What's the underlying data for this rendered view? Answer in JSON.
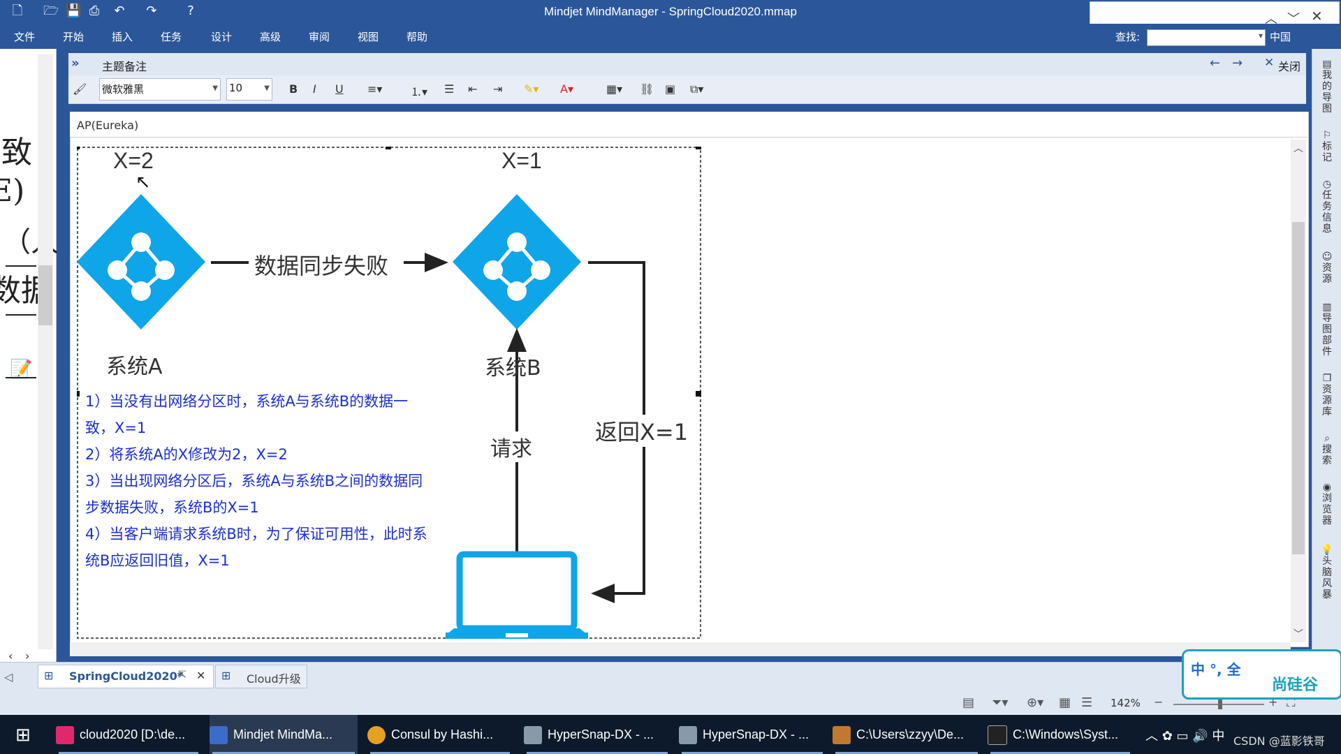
{
  "titlebar": {
    "title": "Mindjet MindManager - SpringCloud2020.mmap"
  },
  "ribbon": {
    "tabs": [
      "文件",
      "开始",
      "插入",
      "任务",
      "设计",
      "高级",
      "审阅",
      "视图",
      "帮助"
    ],
    "find_label": "查找:",
    "lang_label": "中国"
  },
  "notes": {
    "title": "主题备注",
    "close_label": "关闭",
    "font_name": "微软雅黑",
    "font_size": "10",
    "bold": "B",
    "italic": "I",
    "underline": "U",
    "topic": "AP(Eureka)"
  },
  "left_pane": {
    "chars": [
      "致",
      "E)",
      "（人",
      "数据"
    ]
  },
  "figure": {
    "label_x2": "X=2",
    "label_x1": "X=1",
    "arrow_label": "数据同步失败",
    "system_a": "系统A",
    "system_b": "系统B",
    "request": "请求",
    "return": "返回X=1",
    "notes": [
      "1）当没有出网络分区时，系统A与系统B的数据一",
      "致，X=1",
      "2）将系统A的X修改为2，X=2",
      "3）当出现网络分区后，系统A与系统B之间的数据同",
      "步数据失败，系统B的X=1",
      "4）当客户端请求系统B时，为了保证可用性，此时系",
      "统B应返回旧值，X=1"
    ],
    "diamond_color": "#0ea5e9",
    "note_color": "#1a2fd0"
  },
  "right_pane": {
    "items": [
      "我的导图",
      "标记",
      "任务信息",
      "资源",
      "导图部件",
      "资源库",
      "搜索",
      "浏览器",
      "头脑风暴"
    ]
  },
  "doc_tabs": [
    {
      "label": "SpringCloud2020*"
    },
    {
      "label": "Cloud升级"
    }
  ],
  "status": {
    "zoom": "142%"
  },
  "ime": {
    "text": "中 °, 全",
    "brand": "尚硅谷"
  },
  "taskbar": {
    "items": [
      {
        "label": "cloud2020 [D:\\de...",
        "color": "#e0286e"
      },
      {
        "label": "Mindjet MindMa...",
        "color": "#3b6cc9"
      },
      {
        "label": "Consul by Hashi...",
        "color": "#e8a020"
      },
      {
        "label": "HyperSnap-DX - ...",
        "color": "#8899aa"
      },
      {
        "label": "HyperSnap-DX - ...",
        "color": "#8899aa"
      },
      {
        "label": "C:\\Users\\zzyy\\De...",
        "color": "#c07a30"
      },
      {
        "label": "C:\\Windows\\Syst...",
        "color": "#222222"
      }
    ],
    "watermark": "CSDN @蓝影铁哥"
  }
}
